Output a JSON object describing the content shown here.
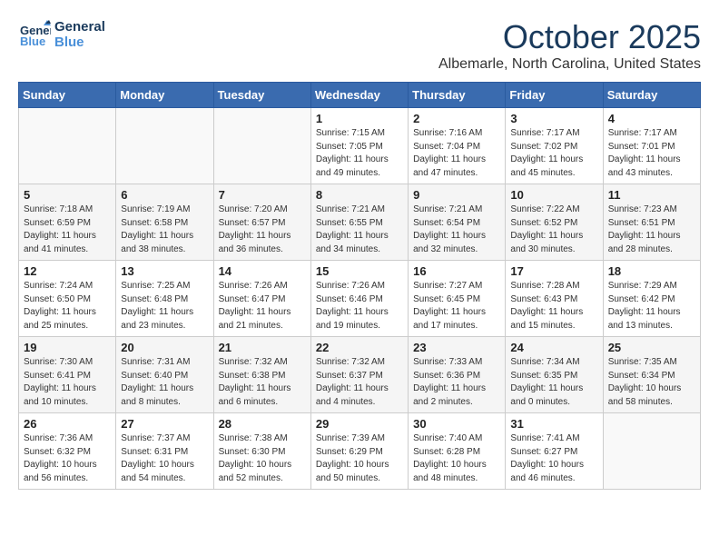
{
  "header": {
    "logo_line1": "General",
    "logo_line2": "Blue",
    "month": "October 2025",
    "location": "Albemarle, North Carolina, United States"
  },
  "weekdays": [
    "Sunday",
    "Monday",
    "Tuesday",
    "Wednesday",
    "Thursday",
    "Friday",
    "Saturday"
  ],
  "weeks": [
    [
      {
        "day": "",
        "info": ""
      },
      {
        "day": "",
        "info": ""
      },
      {
        "day": "",
        "info": ""
      },
      {
        "day": "1",
        "info": "Sunrise: 7:15 AM\nSunset: 7:05 PM\nDaylight: 11 hours\nand 49 minutes."
      },
      {
        "day": "2",
        "info": "Sunrise: 7:16 AM\nSunset: 7:04 PM\nDaylight: 11 hours\nand 47 minutes."
      },
      {
        "day": "3",
        "info": "Sunrise: 7:17 AM\nSunset: 7:02 PM\nDaylight: 11 hours\nand 45 minutes."
      },
      {
        "day": "4",
        "info": "Sunrise: 7:17 AM\nSunset: 7:01 PM\nDaylight: 11 hours\nand 43 minutes."
      }
    ],
    [
      {
        "day": "5",
        "info": "Sunrise: 7:18 AM\nSunset: 6:59 PM\nDaylight: 11 hours\nand 41 minutes."
      },
      {
        "day": "6",
        "info": "Sunrise: 7:19 AM\nSunset: 6:58 PM\nDaylight: 11 hours\nand 38 minutes."
      },
      {
        "day": "7",
        "info": "Sunrise: 7:20 AM\nSunset: 6:57 PM\nDaylight: 11 hours\nand 36 minutes."
      },
      {
        "day": "8",
        "info": "Sunrise: 7:21 AM\nSunset: 6:55 PM\nDaylight: 11 hours\nand 34 minutes."
      },
      {
        "day": "9",
        "info": "Sunrise: 7:21 AM\nSunset: 6:54 PM\nDaylight: 11 hours\nand 32 minutes."
      },
      {
        "day": "10",
        "info": "Sunrise: 7:22 AM\nSunset: 6:52 PM\nDaylight: 11 hours\nand 30 minutes."
      },
      {
        "day": "11",
        "info": "Sunrise: 7:23 AM\nSunset: 6:51 PM\nDaylight: 11 hours\nand 28 minutes."
      }
    ],
    [
      {
        "day": "12",
        "info": "Sunrise: 7:24 AM\nSunset: 6:50 PM\nDaylight: 11 hours\nand 25 minutes."
      },
      {
        "day": "13",
        "info": "Sunrise: 7:25 AM\nSunset: 6:48 PM\nDaylight: 11 hours\nand 23 minutes."
      },
      {
        "day": "14",
        "info": "Sunrise: 7:26 AM\nSunset: 6:47 PM\nDaylight: 11 hours\nand 21 minutes."
      },
      {
        "day": "15",
        "info": "Sunrise: 7:26 AM\nSunset: 6:46 PM\nDaylight: 11 hours\nand 19 minutes."
      },
      {
        "day": "16",
        "info": "Sunrise: 7:27 AM\nSunset: 6:45 PM\nDaylight: 11 hours\nand 17 minutes."
      },
      {
        "day": "17",
        "info": "Sunrise: 7:28 AM\nSunset: 6:43 PM\nDaylight: 11 hours\nand 15 minutes."
      },
      {
        "day": "18",
        "info": "Sunrise: 7:29 AM\nSunset: 6:42 PM\nDaylight: 11 hours\nand 13 minutes."
      }
    ],
    [
      {
        "day": "19",
        "info": "Sunrise: 7:30 AM\nSunset: 6:41 PM\nDaylight: 11 hours\nand 10 minutes."
      },
      {
        "day": "20",
        "info": "Sunrise: 7:31 AM\nSunset: 6:40 PM\nDaylight: 11 hours\nand 8 minutes."
      },
      {
        "day": "21",
        "info": "Sunrise: 7:32 AM\nSunset: 6:38 PM\nDaylight: 11 hours\nand 6 minutes."
      },
      {
        "day": "22",
        "info": "Sunrise: 7:32 AM\nSunset: 6:37 PM\nDaylight: 11 hours\nand 4 minutes."
      },
      {
        "day": "23",
        "info": "Sunrise: 7:33 AM\nSunset: 6:36 PM\nDaylight: 11 hours\nand 2 minutes."
      },
      {
        "day": "24",
        "info": "Sunrise: 7:34 AM\nSunset: 6:35 PM\nDaylight: 11 hours\nand 0 minutes."
      },
      {
        "day": "25",
        "info": "Sunrise: 7:35 AM\nSunset: 6:34 PM\nDaylight: 10 hours\nand 58 minutes."
      }
    ],
    [
      {
        "day": "26",
        "info": "Sunrise: 7:36 AM\nSunset: 6:32 PM\nDaylight: 10 hours\nand 56 minutes."
      },
      {
        "day": "27",
        "info": "Sunrise: 7:37 AM\nSunset: 6:31 PM\nDaylight: 10 hours\nand 54 minutes."
      },
      {
        "day": "28",
        "info": "Sunrise: 7:38 AM\nSunset: 6:30 PM\nDaylight: 10 hours\nand 52 minutes."
      },
      {
        "day": "29",
        "info": "Sunrise: 7:39 AM\nSunset: 6:29 PM\nDaylight: 10 hours\nand 50 minutes."
      },
      {
        "day": "30",
        "info": "Sunrise: 7:40 AM\nSunset: 6:28 PM\nDaylight: 10 hours\nand 48 minutes."
      },
      {
        "day": "31",
        "info": "Sunrise: 7:41 AM\nSunset: 6:27 PM\nDaylight: 10 hours\nand 46 minutes."
      },
      {
        "day": "",
        "info": ""
      }
    ]
  ]
}
